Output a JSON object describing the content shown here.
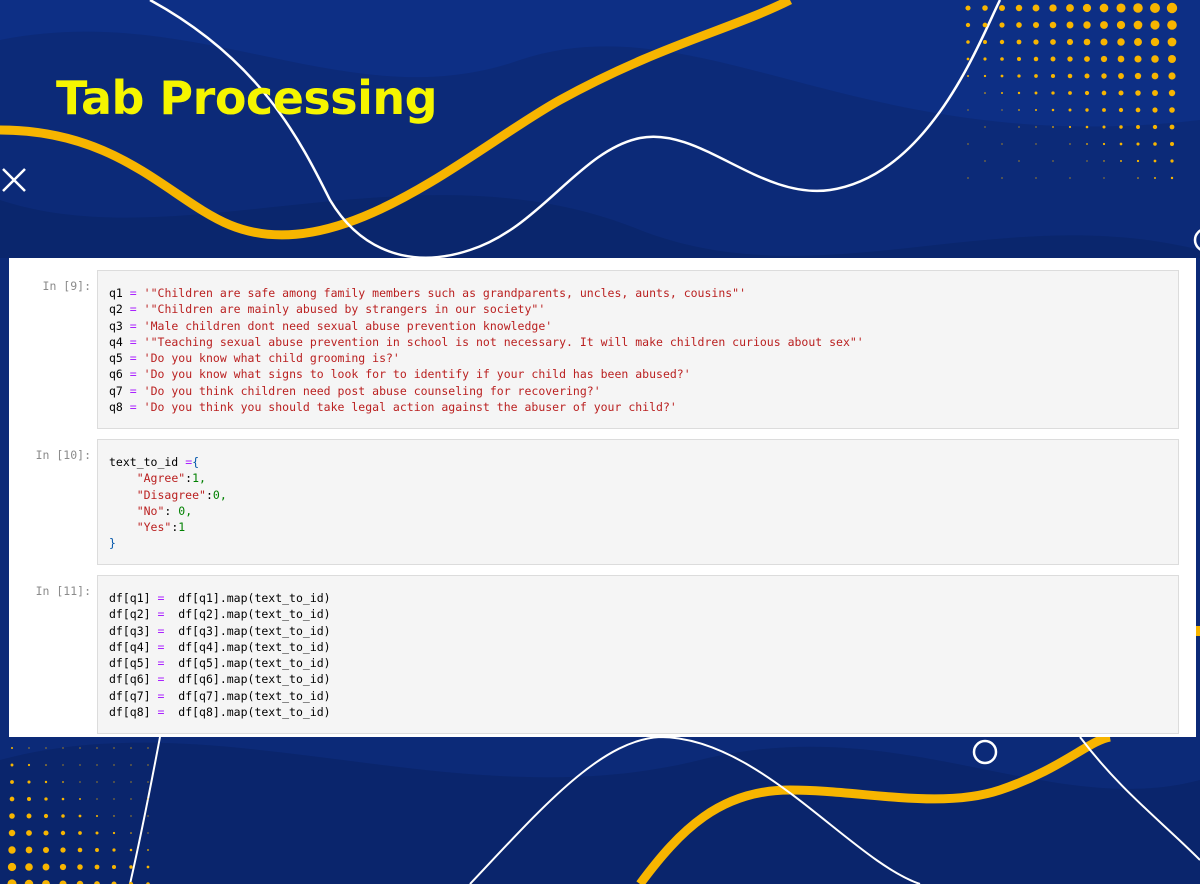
{
  "slide": {
    "title": "Tab Processing"
  },
  "cells": [
    {
      "prompt": "In [9]:",
      "lines": [
        {
          "var": "q1",
          "op": "=",
          "str": "'\"Children are safe among family members such as grandparents, uncles, aunts, cousins\"'"
        },
        {
          "var": "q2",
          "op": "=",
          "str": "'\"Children are mainly abused by strangers in our society\"'"
        },
        {
          "var": "q3",
          "op": "=",
          "str": "'Male children dont need sexual abuse prevention knowledge'"
        },
        {
          "var": "q4",
          "op": "=",
          "str": "'\"Teaching sexual abuse prevention in school is not necessary. It will make children curious about sex\"'"
        },
        {
          "var": "q5",
          "op": "=",
          "str": "'Do you know what child grooming is?'"
        },
        {
          "var": "q6",
          "op": "=",
          "str": "'Do you know what signs to look for to identify if your child has been abused?'"
        },
        {
          "var": "q7",
          "op": "=",
          "str": "'Do you think children need post abuse counseling for recovering?'"
        },
        {
          "var": "q8",
          "op": "=",
          "str": "'Do you think you should take legal action against the abuser of your child?'"
        }
      ]
    },
    {
      "prompt": "In [10]:",
      "open_line": {
        "var": "text_to_id",
        "op": "=",
        "brace": "{"
      },
      "entries": [
        {
          "key": "\"Agree\"",
          "sep": ":",
          "val": "1,"
        },
        {
          "key": "\"Disagree\"",
          "sep": ":",
          "val": "0,"
        },
        {
          "key": "\"No\"",
          "sep": ": ",
          "val": "0,"
        },
        {
          "key": "\"Yes\"",
          "sep": ":",
          "val": "1"
        }
      ],
      "close_brace": "}"
    },
    {
      "prompt": "In [11]:",
      "lines": [
        {
          "lhs": "df[q1]",
          "op": "=",
          "rhs": "df[q1].map(text_to_id)"
        },
        {
          "lhs": "df[q2]",
          "op": "=",
          "rhs": "df[q2].map(text_to_id)"
        },
        {
          "lhs": "df[q3]",
          "op": "=",
          "rhs": "df[q3].map(text_to_id)"
        },
        {
          "lhs": "df[q4]",
          "op": "=",
          "rhs": "df[q4].map(text_to_id)"
        },
        {
          "lhs": "df[q5]",
          "op": "=",
          "rhs": "df[q5].map(text_to_id)"
        },
        {
          "lhs": "df[q6]",
          "op": "=",
          "rhs": "df[q6].map(text_to_id)"
        },
        {
          "lhs": "df[q7]",
          "op": "=",
          "rhs": "df[q7].map(text_to_id)"
        },
        {
          "lhs": "df[q8]",
          "op": "=",
          "rhs": "df[q8].map(text_to_id)"
        }
      ]
    }
  ],
  "colors": {
    "background": "#0c2a78",
    "background_wave": "#0a2466",
    "accent_orange": "#f7b500",
    "title_yellow": "#f5f500",
    "line_white": "#ffffff"
  }
}
